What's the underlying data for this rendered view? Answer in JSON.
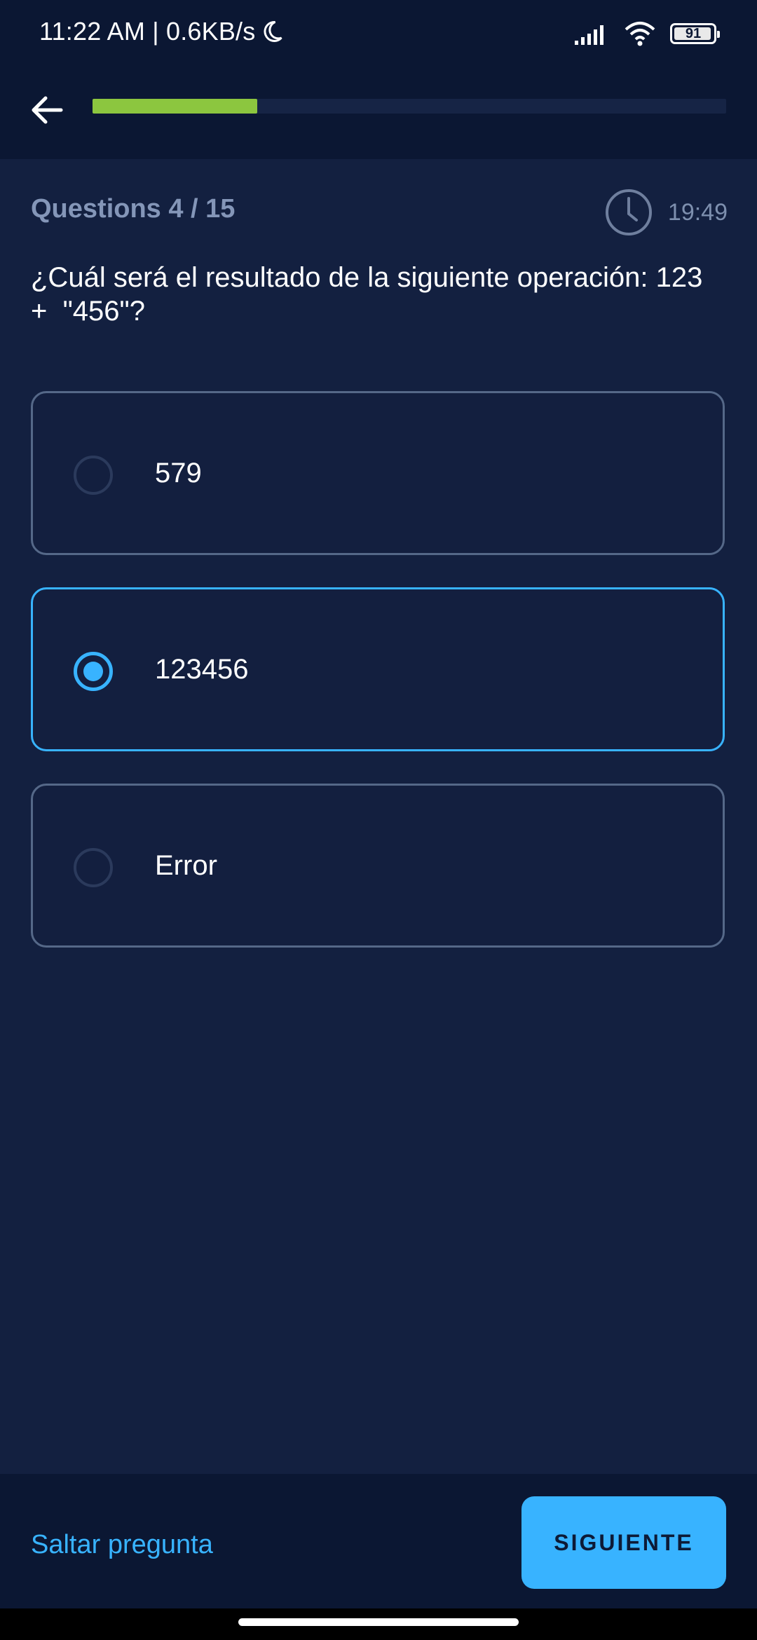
{
  "status_bar": {
    "time_speed": "11:22 AM | 0.6KB/s",
    "battery": "91"
  },
  "quiz": {
    "progress_fraction": 0.26,
    "question_count_label": "Questions 4 / 15",
    "timer": "19:49",
    "question": "¿Cuál será el resultado de la siguiente operación: 123\n+  \"456\"?",
    "options": [
      {
        "label": "579",
        "selected": false
      },
      {
        "label": "123456",
        "selected": true
      },
      {
        "label": "Error",
        "selected": false
      }
    ]
  },
  "footer": {
    "skip_label": "Saltar pregunta",
    "next_label": "SIGUIENTE"
  },
  "colors": {
    "background": "#132040",
    "bar": "#0b1733",
    "accent": "#38b3ff",
    "progress": "#8cc63f"
  },
  "icons": [
    "moon-icon",
    "signal-icon",
    "wifi-icon",
    "battery-icon",
    "back-arrow-icon",
    "clock-icon"
  ]
}
